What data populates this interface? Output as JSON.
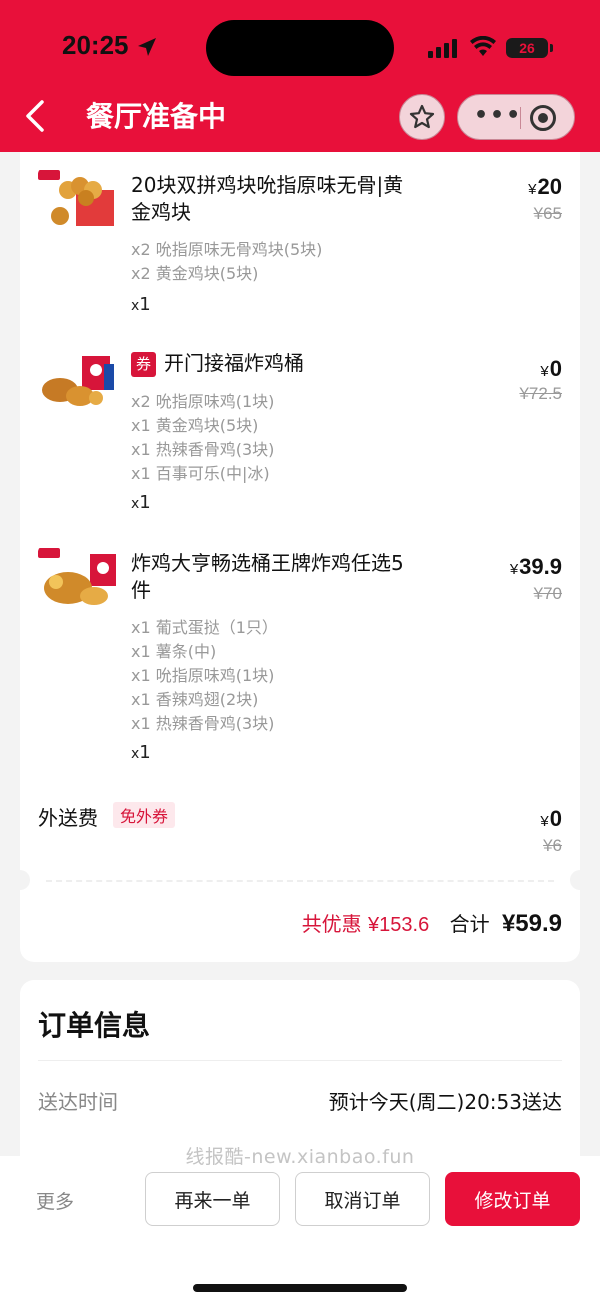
{
  "status_bar": {
    "time": "20:25",
    "battery": "26"
  },
  "header": {
    "title": "餐厅准备中"
  },
  "items": [
    {
      "name": "20块双拼鸡块吮指原味无骨|黄金鸡块",
      "price": "20",
      "original_price": "¥65",
      "subitems": [
        "x2 吮指原味无骨鸡块(5块)",
        "x2 黄金鸡块(5块)"
      ],
      "qty": "1"
    },
    {
      "badge": "券",
      "name": "开门接福炸鸡桶",
      "price": "0",
      "original_price": "¥72.5",
      "subitems": [
        "x2 吮指原味鸡(1块)",
        "x1 黄金鸡块(5块)",
        "x1 热辣香骨鸡(3块)",
        "x1 百事可乐(中|冰)"
      ],
      "qty": "1"
    },
    {
      "name": "炸鸡大亨畅选桶王牌炸鸡任选5件",
      "price": "39.9",
      "original_price": "¥70",
      "subitems": [
        "x1 葡式蛋挞（1只）",
        "x1 薯条(中)",
        "x1 吮指原味鸡(1块)",
        "x1 香辣鸡翅(2块)",
        "x1 热辣香骨鸡(3块)"
      ],
      "qty": "1"
    }
  ],
  "delivery": {
    "label": "外送费",
    "tag": "免外券",
    "price": "0",
    "original_price": "¥6"
  },
  "summary": {
    "discount_label": "共优惠",
    "discount_value": "¥153.6",
    "total_label": "合计",
    "total_value": "¥59.9"
  },
  "order_info": {
    "title": "订单信息",
    "delivery_time_label": "送达时间",
    "delivery_time_value": "预计今天(周二)20:53送达"
  },
  "watermark": "线报酷-new.xianbao.fun",
  "actions": {
    "more": "更多",
    "reorder": "再来一单",
    "cancel": "取消订单",
    "modify": "修改订单"
  },
  "currency_symbol": "¥",
  "qty_prefix": "x",
  "colors": {
    "brand_red": "#e8103a",
    "discount_red": "#d7153a"
  }
}
